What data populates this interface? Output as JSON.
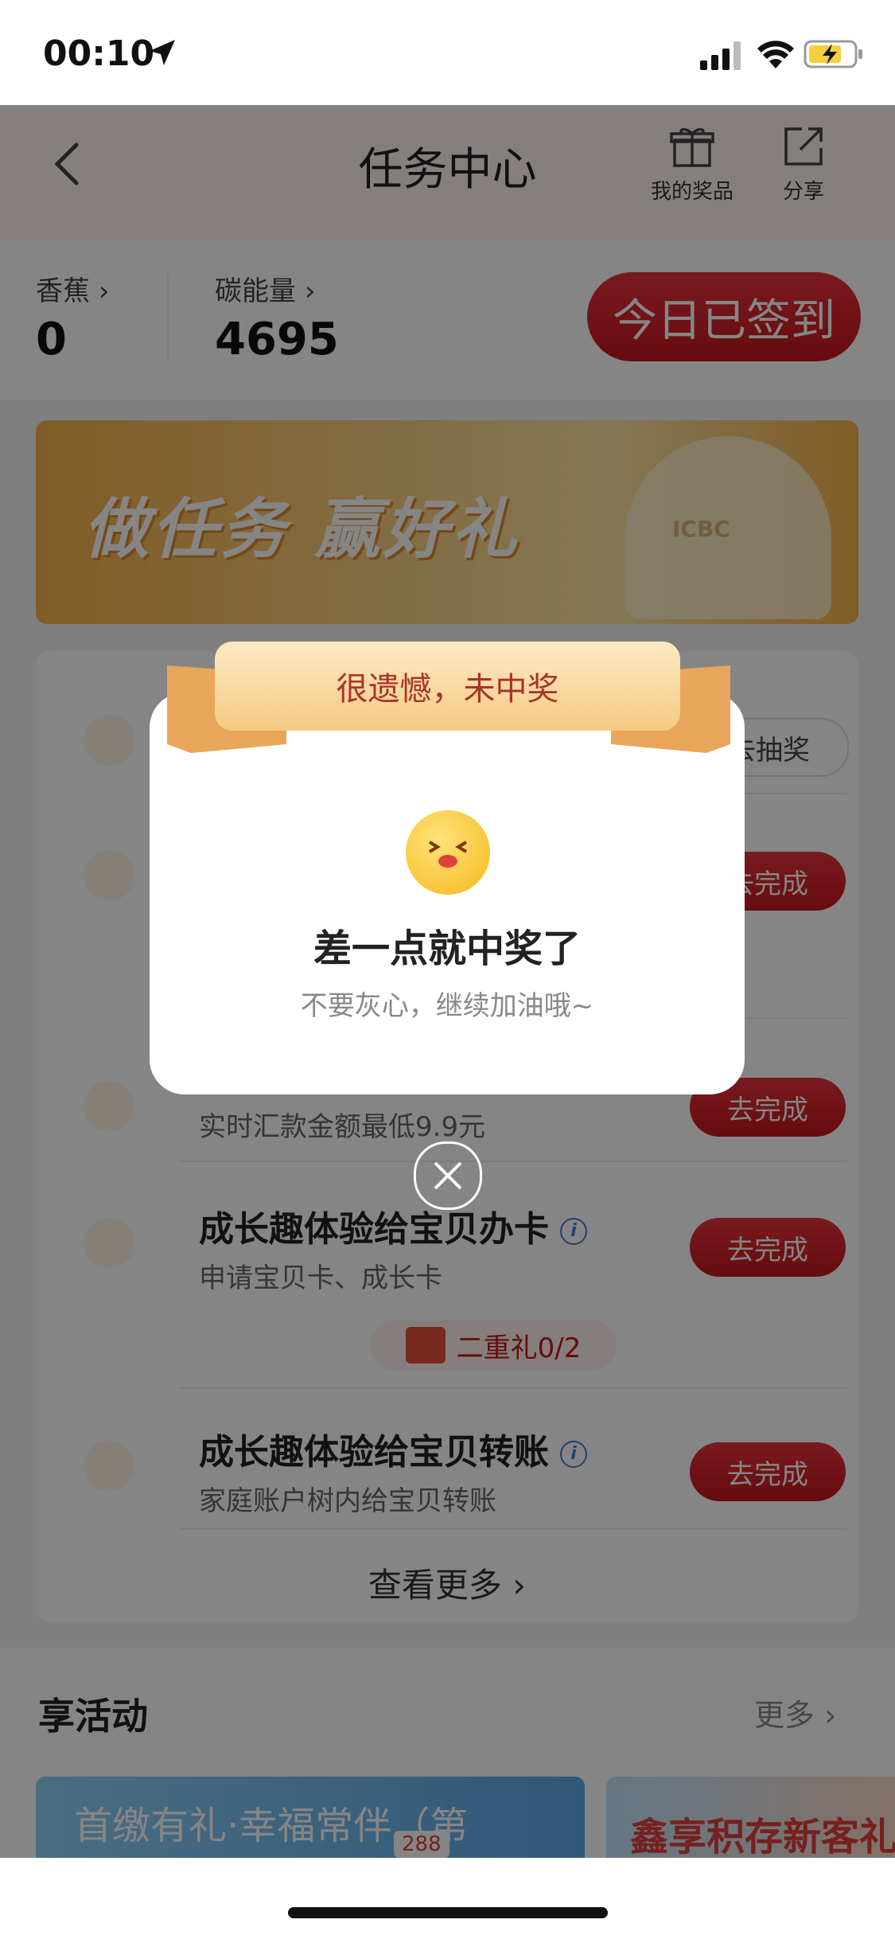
{
  "status_bar": {
    "time": "00:10"
  },
  "header": {
    "title": "任务中心",
    "my_prizes_label": "我的奖品",
    "share_label": "分享"
  },
  "stats": {
    "banana_label": "香蕉",
    "banana_value": "0",
    "carbon_label": "碳能量",
    "carbon_value": "4695",
    "signin_button": "今日已签到"
  },
  "banner": {
    "text": "做任务 赢好礼",
    "logo_text": "ICBC"
  },
  "tasks": {
    "row1_button": "去抽奖",
    "row2_button": "去完成",
    "row3_sub": "实时汇款金额最低9.9元",
    "row3_button": "去完成",
    "row4_title": "成长趣体验给宝贝办卡",
    "row4_sub": "申请宝贝卡、成长卡",
    "row4_button": "去完成",
    "row4_gift": "二重礼0/2",
    "row5_title": "成长趣体验给宝贝转账",
    "row5_sub": "家庭账户树内给宝贝转账",
    "row5_button": "去完成",
    "info_glyph": "i",
    "more_link": "查看更多 ›"
  },
  "activities": {
    "title": "享活动",
    "more": "更多 ›",
    "card1_text": "首缴有礼·幸福常伴（第",
    "card1_badge": "288",
    "card2_text": "鑫享积存新客礼"
  },
  "modal": {
    "ribbon_text": "很遗憾，未中奖",
    "title": "差一点就中奖了",
    "subtitle": "不要灰心，继续加油哦~"
  }
}
